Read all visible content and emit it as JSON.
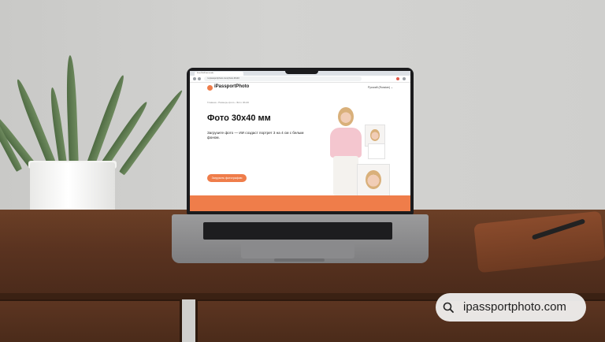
{
  "browser": {
    "tab_title": "Фото 30х40 мм онлайн",
    "url": "ru.ipassportphoto.com/photo-30x40"
  },
  "site": {
    "logo": "iPassportPhoto",
    "language": "Русский (Russian) ⌄",
    "breadcrumb": "Главная › Размеры фото › Фото 30х40",
    "hero_title": "Фото 30х40 мм",
    "hero_subtitle": "Загрузите фото — ИИ создаст портрет 3 на 4 см с белым фоном.",
    "cta_label": "Загрузить фотографию"
  },
  "overlay": {
    "search_text": "ipassportphoto.com"
  },
  "colors": {
    "accent": "#ef7d4a",
    "desk": "#5a3320"
  }
}
